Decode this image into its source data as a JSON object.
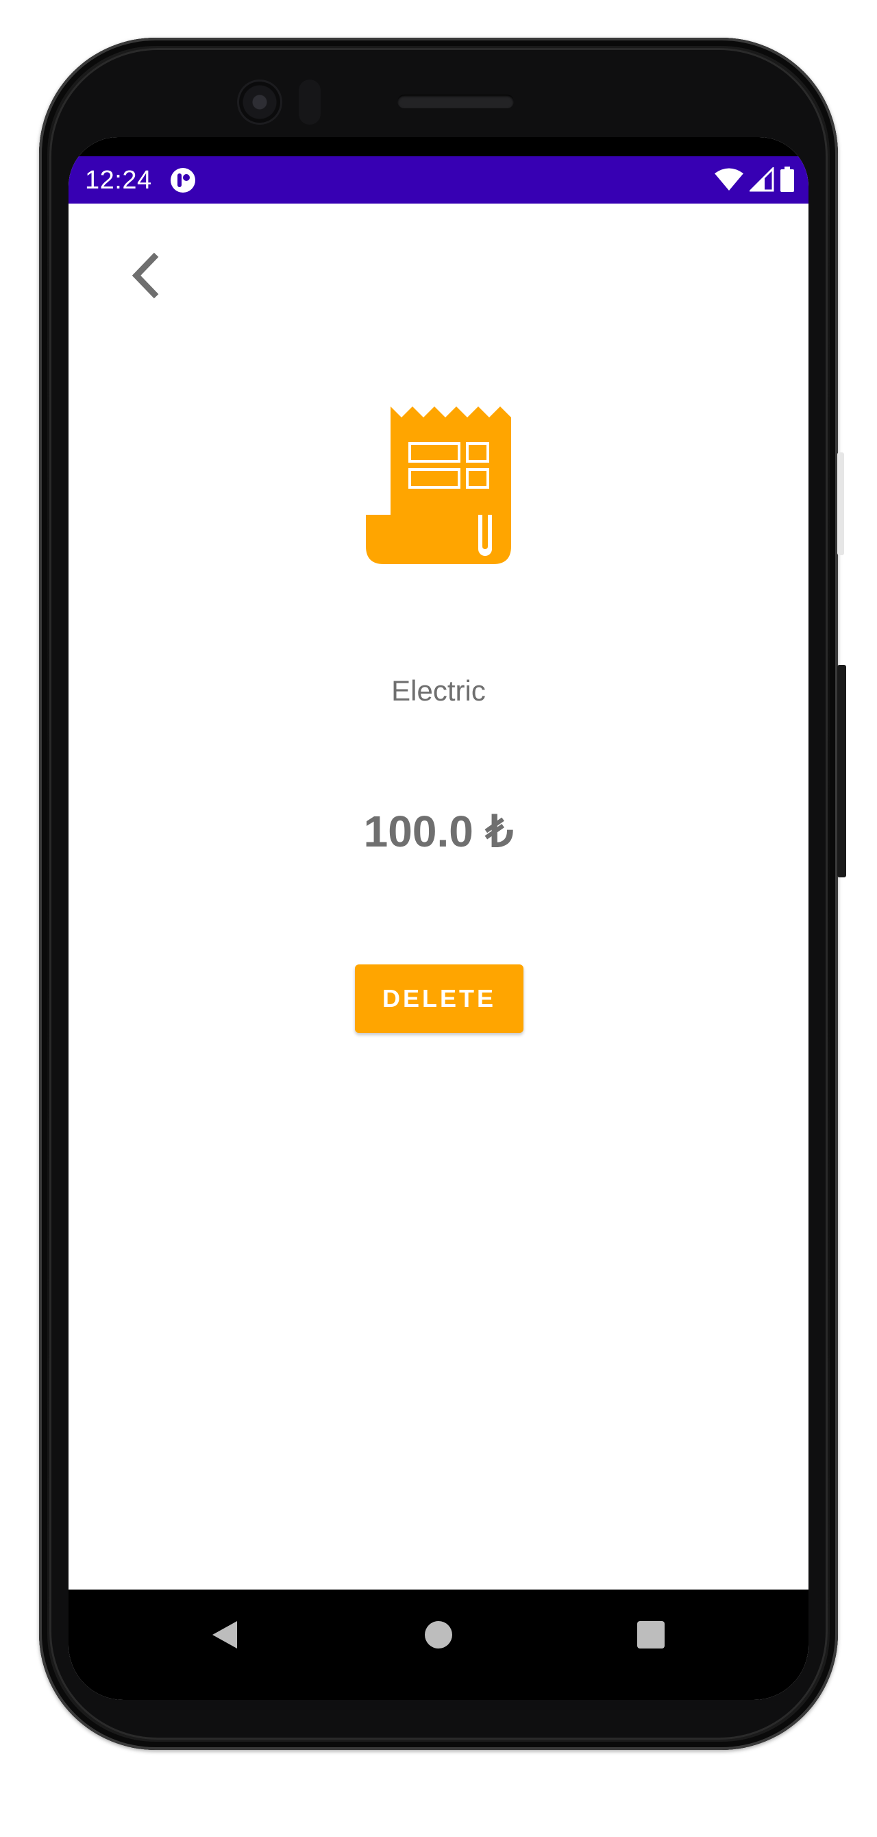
{
  "status_bar": {
    "time": "12:24",
    "background_color": "#3700b3",
    "icons": [
      "app-notification-icon",
      "wifi-icon",
      "cellular-signal-icon",
      "battery-icon"
    ]
  },
  "header": {
    "back_icon": "chevron-left-icon"
  },
  "detail": {
    "icon": "receipt-icon",
    "icon_color": "#ffa500",
    "category": "Electric",
    "amount": "100.0 ₺"
  },
  "actions": {
    "delete_label": "DELETE",
    "delete_color": "#ffa500"
  },
  "navigation_bar": {
    "buttons": [
      "back-triangle-icon",
      "home-circle-icon",
      "recents-square-icon"
    ]
  }
}
